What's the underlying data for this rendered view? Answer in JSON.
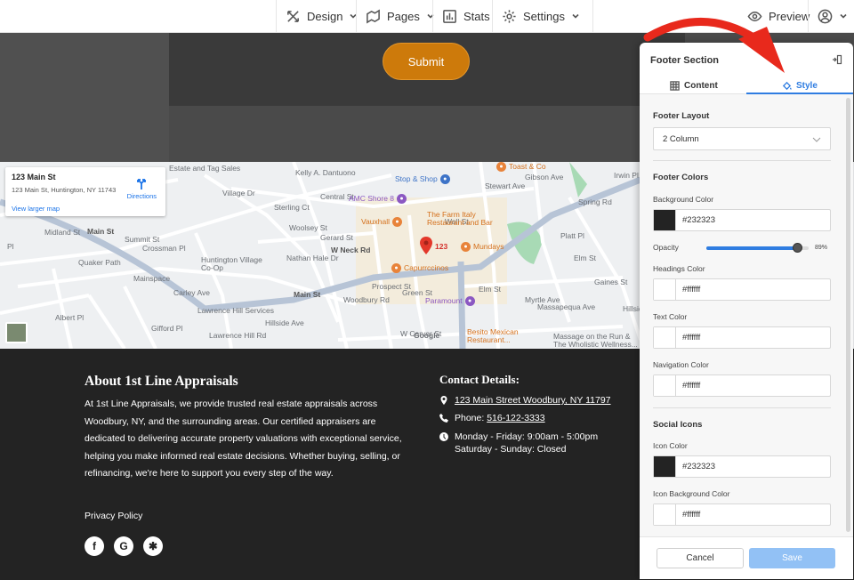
{
  "topnav": {
    "items": [
      {
        "label": "Design",
        "icon": "design-tools-icon",
        "dropdown": true
      },
      {
        "label": "Pages",
        "icon": "pages-icon",
        "dropdown": true
      },
      {
        "label": "Stats",
        "icon": "stats-icon",
        "dropdown": false
      },
      {
        "label": "Settings",
        "icon": "gear-icon",
        "dropdown": true
      }
    ],
    "preview_label": "Preview"
  },
  "form": {
    "submit_label": "Submit"
  },
  "map": {
    "card": {
      "title": "123 Main St",
      "address": "123 Main St, Huntington, NY 11743",
      "larger_map_link": "View larger map",
      "directions_label": "Directions"
    },
    "pin_label": "123",
    "street_labels": [
      "Estate and Tag Sales",
      "Kelly A. Dantuono",
      "Village Dr",
      "Sterling Ct",
      "Central St",
      "Woolsey St",
      "Midland St",
      "Main St",
      "Summit St",
      "Crossman Pl",
      "Quaker Path",
      "Huntington Village Co-Op",
      "Mainspace",
      "Carley Ave",
      "Lawrence Hill Services",
      "Lawrence Hill Rd",
      "Nathan Hale Dr",
      "Gerard St",
      "W Neck Rd",
      "Woodbury Rd",
      "Prospect St",
      "Green St",
      "Main St",
      "Elm St",
      "Elm St",
      "Platt Pl",
      "Gaines St",
      "Spring Rd",
      "Irwin Pl",
      "Gibson Ave",
      "Stewart Ave",
      "Wall St",
      "Albert Pl",
      "Hillside Ave",
      "W Carver St",
      "Massapequa Ave",
      "Myrtle Ave",
      "Massage on the Run & The Wholistic Wellness...",
      "Gifford Pl",
      "Hillside Ave",
      "Pl"
    ],
    "pois": [
      {
        "label": "Toast & Co",
        "kind": "food"
      },
      {
        "label": "Stop & Shop",
        "kind": "shop"
      },
      {
        "label": "AMC Shore 8",
        "kind": "cinema"
      },
      {
        "label": "Vauxhall",
        "kind": "food"
      },
      {
        "label": "The Farm Italy Restaurant and Bar",
        "kind": "food"
      },
      {
        "label": "Mundays",
        "kind": "food"
      },
      {
        "label": "Capurrccinos",
        "kind": "food"
      },
      {
        "label": "Paramount",
        "kind": "venue"
      },
      {
        "label": "Besito Mexican Restaurant...",
        "kind": "food"
      }
    ],
    "google_logo": "Google"
  },
  "footer": {
    "about_title": "About 1st Line Appraisals",
    "about_text": "At 1st Line Appraisals, we provide trusted real estate appraisals across Woodbury, NY, and the surrounding areas. Our certified appraisers are dedicated to delivering accurate property valuations with exceptional service, helping you make informed real estate decisions. Whether buying, selling, or refinancing, we're here to support you every step of the way.",
    "privacy_label": "Privacy Policy",
    "contact_title": "Contact Details:",
    "address": "123 Main Street Woodbury, NY 11797",
    "phone_prefix": "Phone: ",
    "phone": "516-122-3333",
    "hours_line1": "Monday - Friday: 9:00am - 5:00pm",
    "hours_line2": "Saturday - Sunday: Closed",
    "social_icons": [
      "facebook-icon",
      "google-icon",
      "yelp-icon"
    ]
  },
  "panel": {
    "title": "Footer Section",
    "tabs": [
      {
        "label": "Content",
        "active": false
      },
      {
        "label": "Style",
        "active": true
      }
    ],
    "layout_heading": "Footer Layout",
    "layout_value": "2 Column",
    "colors_heading": "Footer Colors",
    "background_color_label": "Background Color",
    "background_color": "#232323",
    "opacity_label": "Opacity",
    "opacity_value": "89%",
    "opacity": 0.89,
    "headings_color_label": "Headings Color",
    "headings_color": "#ffffff",
    "text_color_label": "Text Color",
    "text_color": "#ffffff",
    "nav_color_label": "Navigation Color",
    "nav_color": "#ffffff",
    "social_heading": "Social Icons",
    "icon_color_label": "Icon Color",
    "icon_color": "#232323",
    "icon_bg_color_label": "Icon Background Color",
    "icon_bg_color": "#ffffff",
    "cancel_label": "Cancel",
    "save_label": "Save"
  },
  "colors": {
    "accent": "#2f7de1",
    "submit": "#cd7a0b",
    "annotation_arrow": "#e8291c"
  }
}
